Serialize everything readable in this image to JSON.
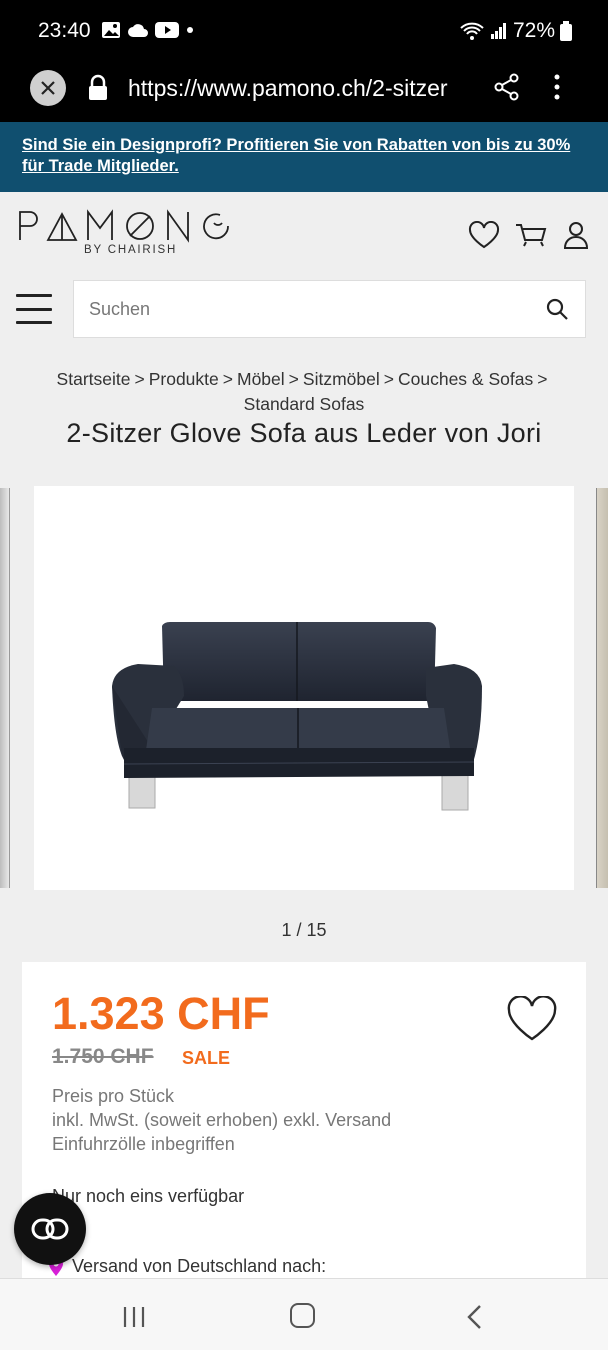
{
  "status_bar": {
    "time": "23:40",
    "battery": "72%"
  },
  "browser": {
    "url": "https://www.pamono.ch/2-sitzer"
  },
  "promo_banner": {
    "text": "Sind Sie ein Designprofi? Profitieren Sie von Rabatten von bis zu 30% für Trade Mitglieder."
  },
  "header": {
    "logo_text": "PAMONO",
    "logo_sub": "BY CHAIRISH"
  },
  "search": {
    "placeholder": "Suchen",
    "value": ""
  },
  "breadcrumb": {
    "items": [
      "Startseite",
      "Produkte",
      "Möbel",
      "Sitzmöbel",
      "Couches & Sofas",
      "Standard Sofas"
    ],
    "separator": ">"
  },
  "product": {
    "title": "2-Sitzer Glove Sofa aus Leder von Jori",
    "image_counter": "1 / 15",
    "price": "1.323 CHF",
    "old_price": "1.750 CHF",
    "sale_label": "SALE",
    "price_info": [
      "Preis pro Stück",
      "inkl. MwSt. (soweit erhoben) exkl. Versand",
      "Einfuhrzölle inbegriffen"
    ],
    "availability": "Nur noch eins verfügbar",
    "shipping": "Versand von Deutschland nach:"
  },
  "colors": {
    "accent": "#f26b1d",
    "banner": "#104f6f",
    "pin": "#d81fd8"
  }
}
